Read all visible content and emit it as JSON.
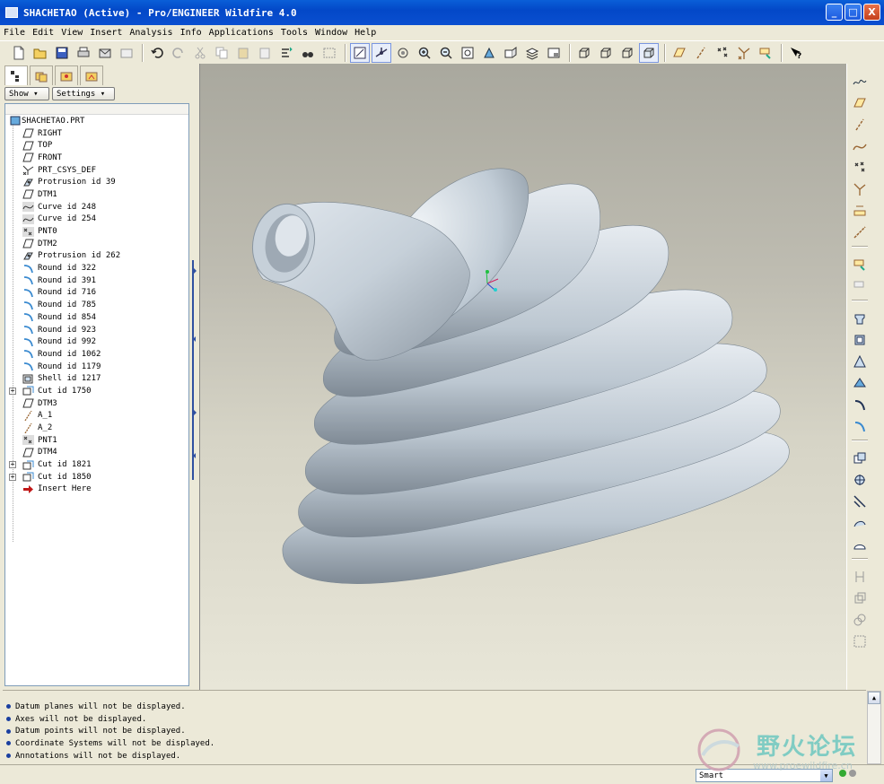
{
  "window": {
    "title": "SHACHETAO (Active) - Pro/ENGINEER Wildfire 4.0",
    "buttons": [
      "_",
      "□",
      "X"
    ]
  },
  "menu": [
    "File",
    "Edit",
    "View",
    "Insert",
    "Analysis",
    "Info",
    "Applications",
    "Tools",
    "Window",
    "Help"
  ],
  "navigator": {
    "show_label": "Show ▾",
    "settings_label": "Settings ▾",
    "tree": [
      {
        "label": "SHACHETAO.PRT",
        "icon": "part-icon",
        "root": true
      },
      {
        "label": "RIGHT",
        "icon": "datum-plane-icon"
      },
      {
        "label": "TOP",
        "icon": "datum-plane-icon"
      },
      {
        "label": "FRONT",
        "icon": "datum-plane-icon"
      },
      {
        "label": "PRT_CSYS_DEF",
        "icon": "csys-icon"
      },
      {
        "label": "Protrusion id 39",
        "icon": "protrusion-icon"
      },
      {
        "label": "DTM1",
        "icon": "datum-plane-icon"
      },
      {
        "label": "Curve id 248",
        "icon": "curve-icon"
      },
      {
        "label": "Curve id 254",
        "icon": "curve-icon"
      },
      {
        "label": "PNT0",
        "icon": "datum-point-icon"
      },
      {
        "label": "DTM2",
        "icon": "datum-plane-icon"
      },
      {
        "label": "Protrusion id 262",
        "icon": "protrusion-icon"
      },
      {
        "label": "Round id 322",
        "icon": "round-icon"
      },
      {
        "label": "Round id 391",
        "icon": "round-icon"
      },
      {
        "label": "Round id 716",
        "icon": "round-icon"
      },
      {
        "label": "Round id 785",
        "icon": "round-icon"
      },
      {
        "label": "Round id 854",
        "icon": "round-icon"
      },
      {
        "label": "Round id 923",
        "icon": "round-icon"
      },
      {
        "label": "Round id 992",
        "icon": "round-icon"
      },
      {
        "label": "Round id 1062",
        "icon": "round-icon"
      },
      {
        "label": "Round id 1179",
        "icon": "round-icon"
      },
      {
        "label": "Shell id 1217",
        "icon": "shell-icon"
      },
      {
        "label": "Cut id 1750",
        "icon": "cut-icon",
        "expandable": true
      },
      {
        "label": "DTM3",
        "icon": "datum-plane-icon"
      },
      {
        "label": "A_1",
        "icon": "axis-icon"
      },
      {
        "label": "A_2",
        "icon": "axis-icon"
      },
      {
        "label": "PNT1",
        "icon": "datum-point-icon"
      },
      {
        "label": "DTM4",
        "icon": "datum-plane-icon"
      },
      {
        "label": "Cut id 1821",
        "icon": "cut-icon",
        "expandable": true
      },
      {
        "label": "Cut id 1850",
        "icon": "cut-icon",
        "expandable": true
      },
      {
        "label": "Insert Here",
        "icon": "insert-here-arrow-icon"
      }
    ]
  },
  "messages": [
    "Datum planes will not be displayed.",
    "Axes will not be displayed.",
    "Datum points will not be displayed.",
    "Coordinate Systems will not be displayed.",
    "Annotations will not be displayed."
  ],
  "status": {
    "filter_value": "Smart"
  },
  "watermark": {
    "text": "野火论坛",
    "url": "www.proewildfire.cn"
  },
  "colors": {
    "model": "#c3cdd6",
    "title_bar": "#0a4fd0",
    "viewport_bg": "#bfbdb2"
  }
}
